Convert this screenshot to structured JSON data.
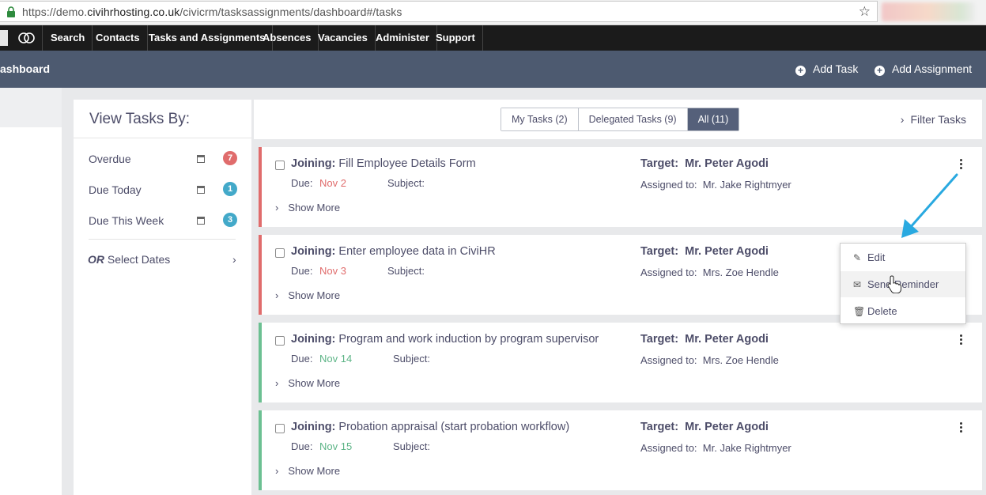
{
  "browser": {
    "url_prefix": "https://demo.",
    "url_host": "civihrhosting.co.uk",
    "url_path": "/civicrm/tasksassignments/dashboard#/tasks"
  },
  "menu": {
    "items": [
      "Search",
      "Contacts",
      "Tasks and Assignments",
      "Absences",
      "Vacancies",
      "Administer",
      "Support"
    ]
  },
  "header": {
    "title": "ashboard",
    "add_task": "Add Task",
    "add_assignment": "Add Assignment"
  },
  "sidebar": {
    "title": "View Tasks By:",
    "filters": [
      {
        "label": "Overdue",
        "count": "7",
        "color": "#e06c6c"
      },
      {
        "label": "Due Today",
        "count": "1",
        "color": "#43a9c9"
      },
      {
        "label": "Due This Week",
        "count": "3",
        "color": "#43a9c9"
      }
    ],
    "or_label": "OR",
    "select_dates": "Select Dates"
  },
  "tabs": {
    "my_tasks": "My Tasks (2)",
    "delegated": "Delegated Tasks (9)",
    "all": "All (11)",
    "active": "all"
  },
  "filter_tasks": "Filter Tasks",
  "labels": {
    "due": "Due:",
    "subject": "Subject:",
    "target": "Target:",
    "assigned_to": "Assigned to:",
    "show_more": "Show More"
  },
  "tasks": [
    {
      "type": "Joining:",
      "title": "Fill Employee Details Form",
      "due": "Nov 2",
      "due_color": "#e06c6c",
      "stripe": "#e06c6c",
      "target": "Mr. Peter Agodi",
      "assignee": "Mr. Jake Rightmyer"
    },
    {
      "type": "Joining:",
      "title": "Enter employee data in CiviHR",
      "due": "Nov 3",
      "due_color": "#e06c6c",
      "stripe": "#e06c6c",
      "target": "Mr. Peter Agodi",
      "assignee": "Mrs. Zoe Hendle"
    },
    {
      "type": "Joining:",
      "title": "Program and work induction by program supervisor",
      "due": "Nov 14",
      "due_color": "#5cb486",
      "stripe": "#6cc092",
      "target": "Mr. Peter Agodi",
      "assignee": "Mrs. Zoe Hendle"
    },
    {
      "type": "Joining:",
      "title": "Probation appraisal (start probation workflow)",
      "due": "Nov 15",
      "due_color": "#5cb486",
      "stripe": "#6cc092",
      "target": "Mr. Peter Agodi",
      "assignee": "Mr. Jake Rightmyer"
    }
  ],
  "dropdown": {
    "edit": "Edit",
    "send_reminder": "Send Reminder",
    "delete": "Delete"
  },
  "colors": {
    "header_bg": "#4d5a70",
    "annotation_arrow": "#29a9e0"
  }
}
